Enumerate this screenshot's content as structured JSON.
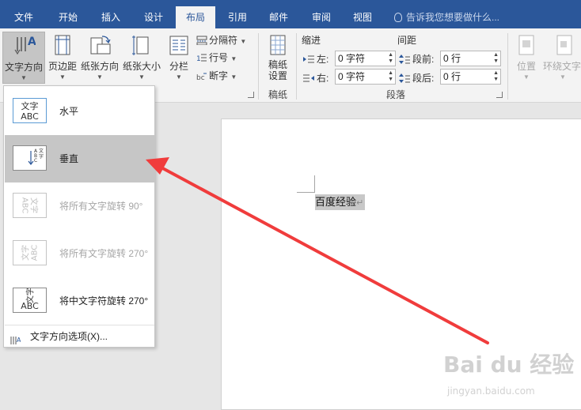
{
  "tabs": [
    {
      "label": "文件"
    },
    {
      "label": "开始"
    },
    {
      "label": "插入"
    },
    {
      "label": "设计"
    },
    {
      "label": "布局"
    },
    {
      "label": "引用"
    },
    {
      "label": "邮件"
    },
    {
      "label": "审阅"
    },
    {
      "label": "视图"
    }
  ],
  "active_tab": "布局",
  "tell_me": {
    "placeholder": "告诉我您想要做什么..."
  },
  "page_setup": {
    "text_direction": "文字方向",
    "margins": "页边距",
    "orientation": "纸张方向",
    "size": "纸张大小",
    "columns": "分栏",
    "breaks": "分隔符",
    "line_numbers": "行号",
    "hyphenation": "断字"
  },
  "manuscript": {
    "button": "稿纸设置",
    "button_line1": "稿纸",
    "button_line2": "设置",
    "group": "稿纸"
  },
  "paragraph": {
    "indent_header": "缩进",
    "spacing_header": "间距",
    "left_label": "左:",
    "left_value": "0 字符",
    "right_label": "右:",
    "right_value": "0 字符",
    "before_label": "段前:",
    "before_value": "0 行",
    "after_label": "段后:",
    "after_value": "0 行",
    "group": "段落"
  },
  "arrange": {
    "position": "位置",
    "wrap_text": "环绕文字"
  },
  "text_direction_menu": {
    "items": [
      {
        "label": "水平",
        "thumb": "文字ABC",
        "enabled": true
      },
      {
        "label": "垂直",
        "thumb": "vertical",
        "enabled": true,
        "selected": true
      },
      {
        "label": "将所有文字旋转 90°",
        "thumb": "rot90",
        "enabled": false
      },
      {
        "label": "将所有文字旋转 270°",
        "thumb": "rot270",
        "enabled": false
      },
      {
        "label": "将中文字符旋转 270°",
        "thumb": "cjk270",
        "enabled": true
      }
    ],
    "options": "文字方向选项(X)..."
  },
  "thumb_text": {
    "cjk": "文字",
    "latin": "ABC"
  },
  "document": {
    "text": "百度经验",
    "paragraph_mark": "↵"
  },
  "watermark": {
    "brand": "Bai du 经验",
    "url": "jingyan.baidu.com"
  },
  "colors": {
    "ribbon_blue": "#2b579a",
    "arrow_red": "#f03c3c",
    "selection_gray": "#c6c6c6"
  }
}
